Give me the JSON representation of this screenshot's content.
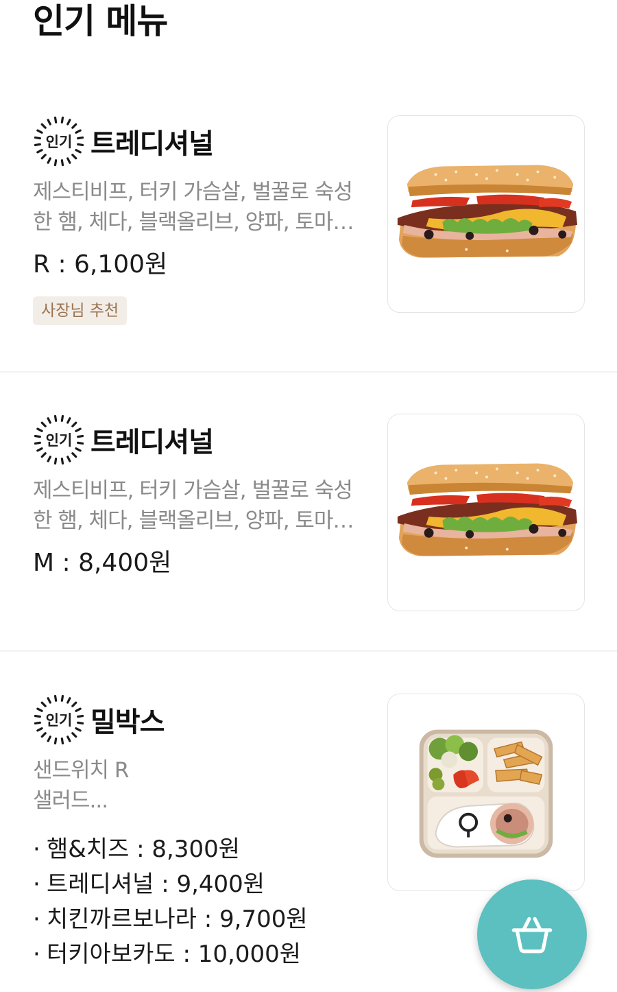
{
  "section": {
    "title": "인기 메뉴"
  },
  "badge": {
    "label": "인기"
  },
  "items": [
    {
      "name": "트레디셔널",
      "desc_line1": "제스티비프, 터키 가슴살, 벌꿀로 숙성",
      "desc_line2": "한 햄, 체다, 블랙올리브, 양파, 토마…",
      "price": "R : 6,100원",
      "tag": "사장님 추천",
      "image": "sandwich-image"
    },
    {
      "name": "트레디셔널",
      "desc_line1": "제스티비프, 터키 가슴살, 벌꿀로 숙성",
      "desc_line2": "한 햄, 체다, 블랙올리브, 양파, 토마…",
      "price": "M : 8,400원",
      "image": "sandwich-image"
    },
    {
      "name": "밀박스",
      "desc_line1": "샌드위치 R",
      "desc_line2": "샐러드...",
      "options": [
        "햄&치즈 : 8,300원",
        "트레디셔널 : 9,400원",
        "치킨까르보나라 : 9,700원",
        "터키아보카도 : 10,000원"
      ],
      "bullet": "·",
      "image": "meal-box-image"
    }
  ],
  "cart": {
    "icon": "basket-icon",
    "color": "#5bc0bf"
  }
}
